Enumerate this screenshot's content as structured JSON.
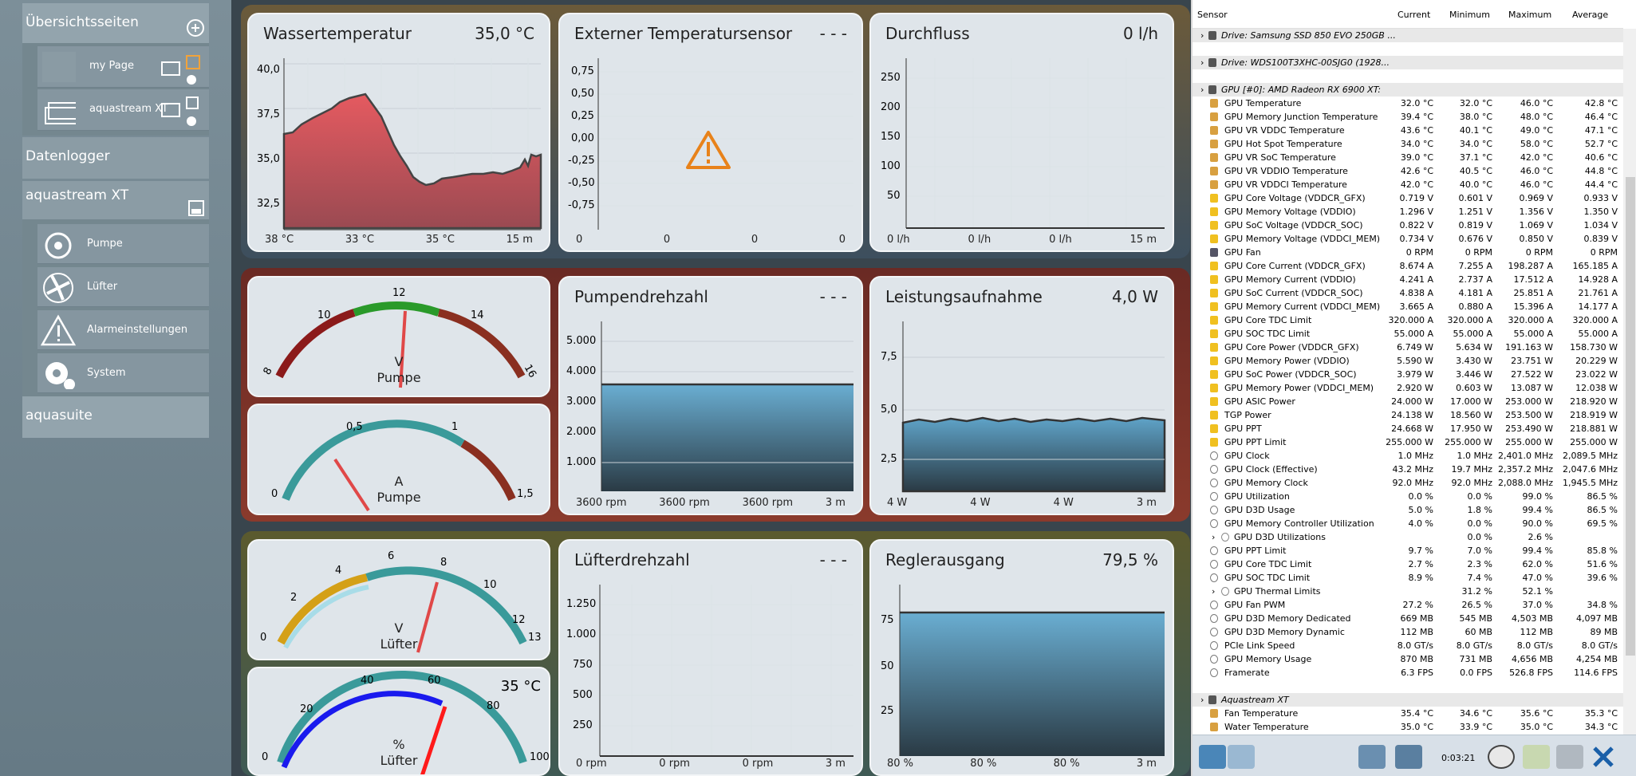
{
  "sidebar": {
    "overview": "Übersichtsseiten",
    "pages": [
      {
        "label": "my Page"
      },
      {
        "label": "aquastream XT"
      }
    ],
    "datalogger": "Datenlogger",
    "device": "aquastream XT",
    "items": [
      {
        "label": "Pumpe"
      },
      {
        "label": "Lüfter"
      },
      {
        "label": "Alarmeinstellungen"
      },
      {
        "label": "System"
      }
    ],
    "aquasuite": "aquasuite",
    "brand": "computer"
  },
  "cards": {
    "water": {
      "title": "Wassertemperatur",
      "value": "35,0 °C",
      "yticks": [
        "40,0",
        "37,5",
        "35,0",
        "32,5"
      ],
      "foot": [
        "38 °C",
        "33 °C",
        "35 °C",
        "15 m"
      ]
    },
    "ext": {
      "title": "Externer Temperatursensor",
      "value": "- - -",
      "yticks": [
        "0,75",
        "0,50",
        "0,25",
        "0,00",
        "-0,25",
        "-0,50",
        "-0,75"
      ],
      "foot": [
        "0",
        "0",
        "0",
        "0"
      ]
    },
    "flow": {
      "title": "Durchfluss",
      "value": "0 l/h",
      "yticks": [
        "250",
        "200",
        "150",
        "100",
        "50"
      ],
      "foot": [
        "0 l/h",
        "0 l/h",
        "0 l/h",
        "15 m"
      ]
    },
    "pump": {
      "title": "Pumpendrehzahl",
      "value": "- - -",
      "yticks": [
        "5.000",
        "4.000",
        "3.000",
        "2.000",
        "1.000"
      ],
      "foot": [
        "3600 rpm",
        "3600 rpm",
        "3600 rpm",
        "3 m"
      ]
    },
    "power": {
      "title": "Leistungsaufnahme",
      "value": "4,0 W",
      "yticks": [
        "7,5",
        "5,0",
        "2,5"
      ],
      "foot": [
        "4 W",
        "4 W",
        "4 W",
        "3 m"
      ]
    },
    "fan": {
      "title": "Lüfterdrehzahl",
      "value": "- - -",
      "yticks": [
        "1.250",
        "1.000",
        "750",
        "500",
        "250"
      ],
      "foot": [
        "0 rpm",
        "0 rpm",
        "0 rpm",
        "3 m"
      ]
    },
    "ctrl": {
      "title": "Reglerausgang",
      "value": "79,5 %",
      "yticks": [
        "75",
        "50",
        "25"
      ],
      "foot": [
        "80 %",
        "80 %",
        "80 %",
        "3 m"
      ]
    }
  },
  "gauges": {
    "g1": {
      "unit": "V",
      "name": "Pumpe",
      "ticks": [
        "8",
        "10",
        "12",
        "14",
        "16"
      ],
      "value": 12.2
    },
    "g2": {
      "unit": "A",
      "name": "Pumpe",
      "ticks": [
        "0",
        "0,5",
        "1",
        "1,5"
      ],
      "value": 0.22
    },
    "g3": {
      "unit": "V",
      "name": "Lüfter",
      "ticks": [
        "0",
        "2",
        "4",
        "6",
        "8",
        "10",
        "12",
        "13"
      ],
      "value": 8.1
    },
    "g4": {
      "unit": "%",
      "name": "Lüfter",
      "ticks": [
        "0",
        "20",
        "40",
        "60",
        "80",
        "100"
      ],
      "value": 60,
      "temp": "35 °C"
    }
  },
  "hwinfo": {
    "headers": [
      "Sensor",
      "Current",
      "Minimum",
      "Maximum",
      "Average"
    ],
    "rows": [
      [
        "Drive: Samsung SSD 850 EVO 250GB ...",
        "",
        "",
        "",
        "",
        "g"
      ],
      [
        "",
        "",
        "",
        "",
        "",
        "s"
      ],
      [
        "Drive: WDS100T3XHC-00SJG0 (1928...",
        "",
        "",
        "",
        "",
        "g"
      ],
      [
        "",
        "",
        "",
        "",
        "",
        "s"
      ],
      [
        "GPU [#0]: AMD Radeon RX 6900 XT:",
        "",
        "",
        "",
        "",
        "g"
      ],
      [
        "GPU Temperature",
        "32.0 °C",
        "32.0 °C",
        "46.0 °C",
        "42.8 °C",
        "t"
      ],
      [
        "GPU Memory Junction Temperature",
        "39.4 °C",
        "38.0 °C",
        "48.0 °C",
        "46.4 °C",
        "t"
      ],
      [
        "GPU VR VDDC Temperature",
        "43.6 °C",
        "40.1 °C",
        "49.0 °C",
        "47.1 °C",
        "t"
      ],
      [
        "GPU Hot Spot Temperature",
        "34.0 °C",
        "34.0 °C",
        "58.0 °C",
        "52.7 °C",
        "t"
      ],
      [
        "GPU VR SoC Temperature",
        "39.0 °C",
        "37.1 °C",
        "42.0 °C",
        "40.6 °C",
        "t"
      ],
      [
        "GPU VR VDDIO Temperature",
        "42.6 °C",
        "40.5 °C",
        "46.0 °C",
        "44.8 °C",
        "t"
      ],
      [
        "GPU VR VDDCI Temperature",
        "42.0 °C",
        "40.0 °C",
        "46.0 °C",
        "44.4 °C",
        "t"
      ],
      [
        "GPU Core Voltage (VDDCR_GFX)",
        "0.719 V",
        "0.601 V",
        "0.969 V",
        "0.933 V",
        "v"
      ],
      [
        "GPU Memory Voltage (VDDIO)",
        "1.296 V",
        "1.251 V",
        "1.356 V",
        "1.350 V",
        "v"
      ],
      [
        "GPU SoC Voltage (VDDCR_SOC)",
        "0.822 V",
        "0.819 V",
        "1.069 V",
        "1.034 V",
        "v"
      ],
      [
        "GPU Memory Voltage (VDDCI_MEM)",
        "0.734 V",
        "0.676 V",
        "0.850 V",
        "0.839 V",
        "v"
      ],
      [
        "GPU Fan",
        "0 RPM",
        "0 RPM",
        "0 RPM",
        "0 RPM",
        "f"
      ],
      [
        "GPU Core Current (VDDCR_GFX)",
        "8.674 A",
        "7.255 A",
        "198.287 A",
        "165.185 A",
        "v"
      ],
      [
        "GPU Memory Current (VDDIO)",
        "4.241 A",
        "2.737 A",
        "17.512 A",
        "14.928 A",
        "v"
      ],
      [
        "GPU SoC Current (VDDCR_SOC)",
        "4.838 A",
        "4.181 A",
        "25.851 A",
        "21.761 A",
        "v"
      ],
      [
        "GPU Memory Current (VDDCI_MEM)",
        "3.665 A",
        "0.880 A",
        "15.396 A",
        "14.177 A",
        "v"
      ],
      [
        "GPU Core TDC Limit",
        "320.000 A",
        "320.000 A",
        "320.000 A",
        "320.000 A",
        "v"
      ],
      [
        "GPU SOC TDC Limit",
        "55.000 A",
        "55.000 A",
        "55.000 A",
        "55.000 A",
        "v"
      ],
      [
        "GPU Core Power (VDDCR_GFX)",
        "6.749 W",
        "5.634 W",
        "191.163 W",
        "158.730 W",
        "v"
      ],
      [
        "GPU Memory Power (VDDIO)",
        "5.590 W",
        "3.430 W",
        "23.751 W",
        "20.229 W",
        "v"
      ],
      [
        "GPU SoC Power (VDDCR_SOC)",
        "3.979 W",
        "3.446 W",
        "27.522 W",
        "23.022 W",
        "v"
      ],
      [
        "GPU Memory Power (VDDCI_MEM)",
        "2.920 W",
        "0.603 W",
        "13.087 W",
        "12.038 W",
        "v"
      ],
      [
        "GPU ASIC Power",
        "24.000 W",
        "17.000 W",
        "253.000 W",
        "218.920 W",
        "v"
      ],
      [
        "TGP Power",
        "24.138 W",
        "18.560 W",
        "253.500 W",
        "218.919 W",
        "v"
      ],
      [
        "GPU PPT",
        "24.668 W",
        "17.950 W",
        "253.490 W",
        "218.881 W",
        "v"
      ],
      [
        "GPU PPT Limit",
        "255.000 W",
        "255.000 W",
        "255.000 W",
        "255.000 W",
        "v"
      ],
      [
        "GPU Clock",
        "1.0 MHz",
        "1.0 MHz",
        "2,401.0 MHz",
        "2,089.5 MHz",
        "o"
      ],
      [
        "GPU Clock (Effective)",
        "43.2 MHz",
        "19.7 MHz",
        "2,357.2 MHz",
        "2,047.6 MHz",
        "o"
      ],
      [
        "GPU Memory Clock",
        "92.0 MHz",
        "92.0 MHz",
        "2,088.0 MHz",
        "1,945.5 MHz",
        "o"
      ],
      [
        "GPU Utilization",
        "0.0 %",
        "0.0 %",
        "99.0 %",
        "86.5 %",
        "o"
      ],
      [
        "GPU D3D Usage",
        "5.0 %",
        "1.8 %",
        "99.4 %",
        "86.5 %",
        "o"
      ],
      [
        "GPU Memory Controller Utilization",
        "4.0 %",
        "0.0 %",
        "90.0 %",
        "69.5 %",
        "o"
      ],
      [
        "GPU D3D Utilizations",
        "",
        "0.0 %",
        "2.6 %",
        "",
        "x"
      ],
      [
        "GPU PPT Limit",
        "9.7 %",
        "7.0 %",
        "99.4 %",
        "85.8 %",
        "o"
      ],
      [
        "GPU Core TDC Limit",
        "2.7 %",
        "2.3 %",
        "62.0 %",
        "51.6 %",
        "o"
      ],
      [
        "GPU SOC TDC Limit",
        "8.9 %",
        "7.4 %",
        "47.0 %",
        "39.6 %",
        "o"
      ],
      [
        "GPU Thermal Limits",
        "",
        "31.2 %",
        "52.1 %",
        "",
        "x"
      ],
      [
        "GPU Fan PWM",
        "27.2 %",
        "26.5 %",
        "37.0 %",
        "34.8 %",
        "o"
      ],
      [
        "GPU D3D Memory Dedicated",
        "669 MB",
        "545 MB",
        "4,503 MB",
        "4,097 MB",
        "o"
      ],
      [
        "GPU D3D Memory Dynamic",
        "112 MB",
        "60 MB",
        "112 MB",
        "89 MB",
        "o"
      ],
      [
        "PCIe Link Speed",
        "8.0 GT/s",
        "8.0 GT/s",
        "8.0 GT/s",
        "8.0 GT/s",
        "o"
      ],
      [
        "GPU Memory Usage",
        "870 MB",
        "731 MB",
        "4,656 MB",
        "4,254 MB",
        "o"
      ],
      [
        "Framerate",
        "6.3 FPS",
        "0.0 FPS",
        "526.8 FPS",
        "114.6 FPS",
        "o"
      ],
      [
        "",
        "",
        "",
        "",
        "",
        "s"
      ],
      [
        "Aquastream XT",
        "",
        "",
        "",
        "",
        "g"
      ],
      [
        "Fan Temperature",
        "35.4 °C",
        "34.6 °C",
        "35.6 °C",
        "35.3 °C",
        "t"
      ],
      [
        "Water Temperature",
        "35.0 °C",
        "33.9 °C",
        "35.0 °C",
        "34.3 °C",
        "t"
      ]
    ],
    "time": "0:03:21"
  },
  "colors": {
    "accent": "#4a86b8",
    "waterFill": "#d94a52",
    "barFill": "#5fa3c8",
    "warning": "#e8821a"
  }
}
